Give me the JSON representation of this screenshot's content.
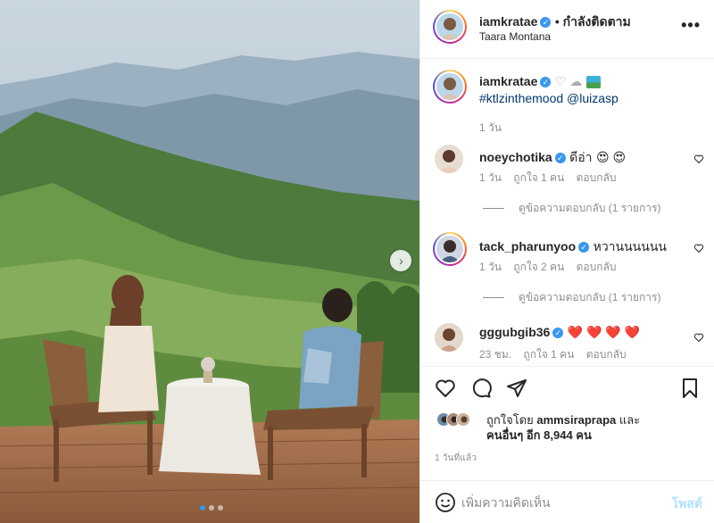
{
  "post": {
    "author": "iamkratae",
    "follow_status": "• กำลังติดตาม",
    "location": "Taara Montana",
    "more_menu": "•••",
    "verified_mark": "✓"
  },
  "caption": {
    "author": "iamkratae",
    "emojis": "♡ ☁",
    "text": "#ktlzinthemood @luizasp",
    "time": "1 วัน"
  },
  "comments": [
    {
      "user": "noeychotika",
      "text": "ดีอ่า",
      "emoji": "😍 😍",
      "time": "1 วัน",
      "likes": "ถูกใจ 1 คน",
      "reply": "ตอบกลับ",
      "view_replies": "ดูข้อความตอบกลับ (1 รายการ)"
    },
    {
      "user": "tack_pharunyoo",
      "text": "หวานนนนนน",
      "emoji": "",
      "time": "1 วัน",
      "likes": "ถูกใจ 2 คน",
      "reply": "ตอบกลับ",
      "view_replies": "ดูข้อความตอบกลับ (1 รายการ)"
    },
    {
      "user": "gggubgib36",
      "text": "",
      "emoji": "❤️ ❤️ ❤️ ❤️",
      "time": "23 ชม.",
      "likes": "ถูกใจ 1 คน",
      "reply": "ตอบกลับ",
      "view_replies": ""
    }
  ],
  "likes_summary": {
    "prefix": "ถูกใจโดย",
    "user": "ammsiraprapa",
    "and": "และ",
    "others": "คนอื่นๆ อีก 8,944 คน"
  },
  "posted_ago": "1 วันที่แล้ว",
  "add_comment": {
    "placeholder": "เพิ่มความคิดเห็น",
    "post_label": "โพสต์"
  },
  "carousel": {
    "next_label": "›",
    "total": 3,
    "active": 0
  },
  "colors": {
    "accent": "#3897f0",
    "text": "#262626",
    "muted": "#8e8e8e",
    "post_disabled": "#b2dffc"
  }
}
